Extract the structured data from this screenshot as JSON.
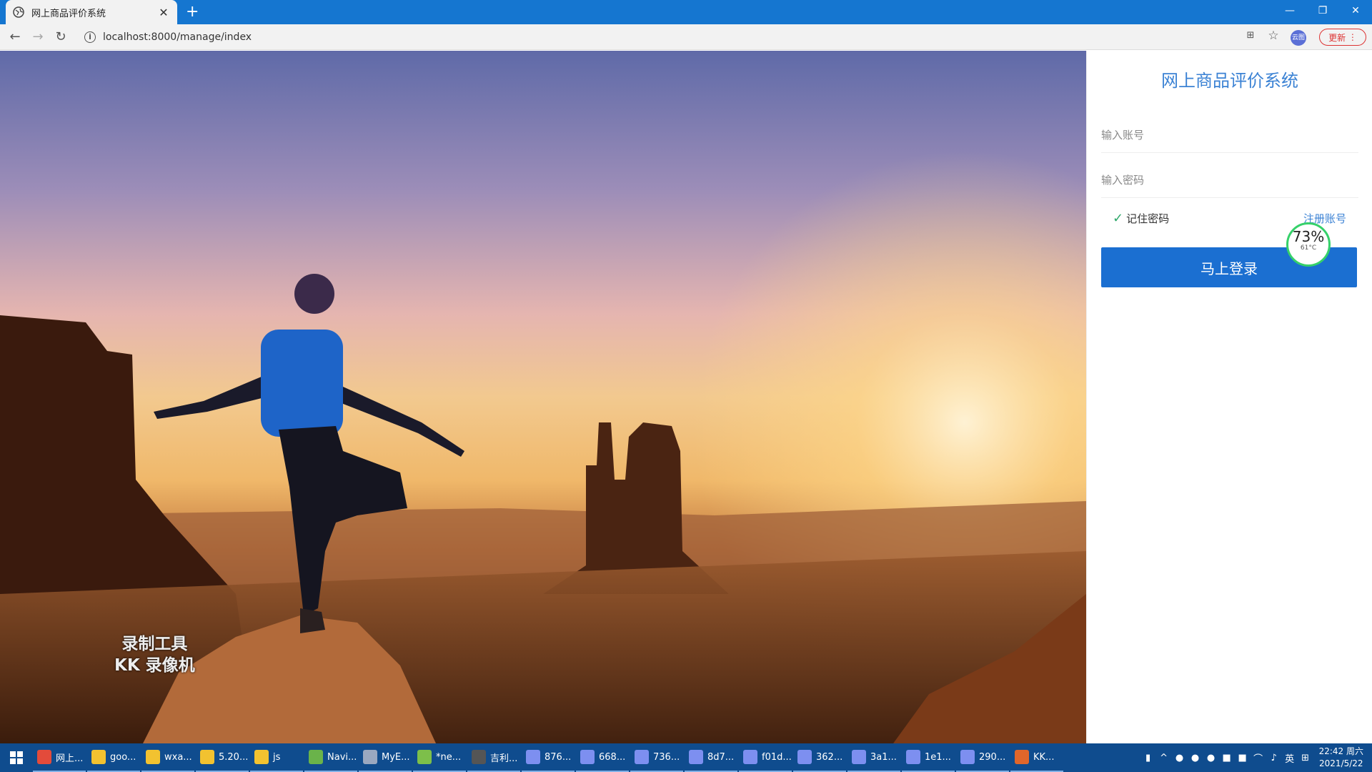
{
  "browser": {
    "tab_title": "网上商品评价系统",
    "new_tab_label": "+",
    "url": "localhost:8000/manage/index",
    "profile_label": "云图",
    "update_label": "更新"
  },
  "login": {
    "title": "网上商品评价系统",
    "account_placeholder": "输入账号",
    "password_placeholder": "输入密码",
    "remember_label": "记住密码",
    "register_link": "注册账号",
    "login_button": "马上登录"
  },
  "cpu_widget": {
    "percent": "73%",
    "temperature": "61°C"
  },
  "watermark": {
    "line1": "录制工具",
    "line2": "KK 录像机"
  },
  "taskbar": {
    "items": [
      {
        "label": "网上...",
        "color": "#e34b3b"
      },
      {
        "label": "goo...",
        "color": "#f2c230"
      },
      {
        "label": "wxa...",
        "color": "#f2c230"
      },
      {
        "label": "5.20...",
        "color": "#f2c230"
      },
      {
        "label": "js",
        "color": "#f2c230"
      },
      {
        "label": "Navi...",
        "color": "#6ab34a"
      },
      {
        "label": "MyE...",
        "color": "#9aa8c0"
      },
      {
        "label": "*ne...",
        "color": "#7dbf4a"
      },
      {
        "label": "吉利...",
        "color": "#555555"
      },
      {
        "label": "876...",
        "color": "#7d8ff0"
      },
      {
        "label": "668...",
        "color": "#7d8ff0"
      },
      {
        "label": "736...",
        "color": "#7d8ff0"
      },
      {
        "label": "8d7...",
        "color": "#7d8ff0"
      },
      {
        "label": "f01d...",
        "color": "#7d8ff0"
      },
      {
        "label": "362...",
        "color": "#7d8ff0"
      },
      {
        "label": "3a1...",
        "color": "#7d8ff0"
      },
      {
        "label": "1e1...",
        "color": "#7d8ff0"
      },
      {
        "label": "290...",
        "color": "#7d8ff0"
      },
      {
        "label": "KK...",
        "color": "#e0662a"
      }
    ],
    "ime": "英",
    "time": "22:42 周六",
    "date": "2021/5/22"
  }
}
